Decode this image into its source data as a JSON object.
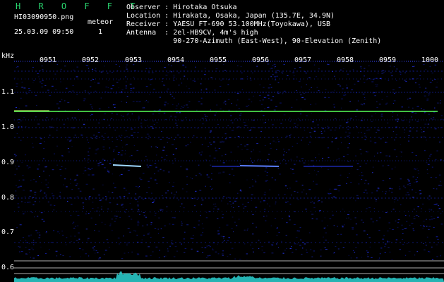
{
  "header": {
    "brand": "H R O F F T",
    "filename": "HI03090950.png",
    "mode_label": "meteor",
    "datetime": "25.03.09 09:50",
    "count": "1"
  },
  "station": {
    "observer": "Observer : Hirotaka Otsuka",
    "location": "Location : Hirakata, Osaka, Japan (135.7E, 34.9N)",
    "receiver": "Receiver : YAESU FT-690 53.100MHz(Toyokawa), USB",
    "antenna": "Antenna  : 2el-HB9CV, 4m's high",
    "antenna2": "           90-270-Azimuth (East-West), 90-Elevation (Zenith)"
  },
  "axis": {
    "y_unit": "kHz",
    "y_ticks": [
      "1.1",
      "1.0",
      "0.9",
      "0.8",
      "0.7",
      "0.6"
    ],
    "x_ticks": [
      "0951",
      "0952",
      "0953",
      "0954",
      "0955",
      "0956",
      "0957",
      "0958",
      "0959",
      "1000"
    ]
  },
  "colors": {
    "background": "#000000",
    "noise": "#1a2cff",
    "carrier": "#59ff59",
    "echo": "#9fd8ff",
    "baseline_noise": "#29c7c7",
    "brand": "#29d66f"
  }
}
